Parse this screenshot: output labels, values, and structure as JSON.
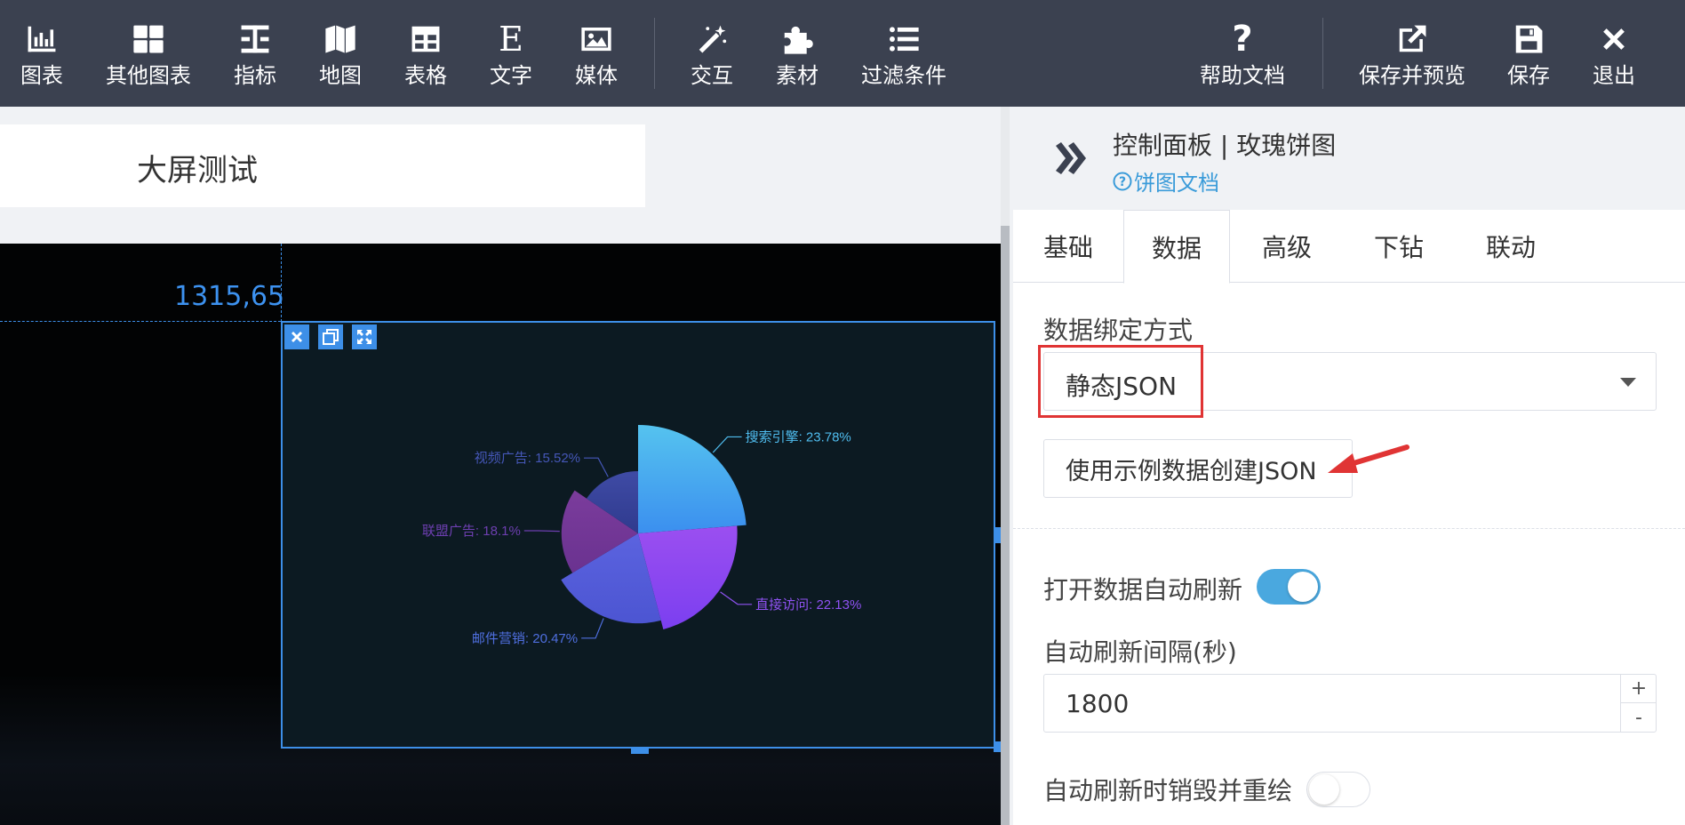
{
  "toolbar": {
    "left_items": [
      {
        "label": "图表",
        "icon": "bar-chart-icon"
      },
      {
        "label": "其他图表",
        "icon": "grid-icon"
      },
      {
        "label": "指标",
        "icon": "indicator-icon"
      },
      {
        "label": "地图",
        "icon": "map-icon"
      },
      {
        "label": "表格",
        "icon": "table-icon"
      },
      {
        "label": "文字",
        "icon": "text-icon"
      },
      {
        "label": "媒体",
        "icon": "image-icon"
      },
      {
        "label": "交互",
        "icon": "magic-wand-icon"
      },
      {
        "label": "素材",
        "icon": "puzzle-icon"
      },
      {
        "label": "过滤条件",
        "icon": "list-icon"
      }
    ],
    "right_items": [
      {
        "label": "帮助文档",
        "icon": "question-icon"
      },
      {
        "label": "保存并预览",
        "icon": "external-link-icon"
      },
      {
        "label": "保存",
        "icon": "floppy-icon"
      },
      {
        "label": "退出",
        "icon": "close-icon"
      }
    ]
  },
  "canvas": {
    "title": "大屏测试",
    "coordinate_readout": "1315,65"
  },
  "chart_data": {
    "type": "pie",
    "variant": "rose",
    "categories": [
      "搜索引擎",
      "直接访问",
      "邮件营销",
      "联盟广告",
      "视频广告"
    ],
    "labels": [
      "搜索引擎: 23.78%",
      "直接访问: 22.13%",
      "邮件营销: 20.47%",
      "联盟广告: 18.1%",
      "视频广告: 15.52%"
    ],
    "values": [
      23.78,
      22.13,
      20.47,
      18.1,
      15.52
    ],
    "colors": {
      "slice_top": [
        "#55c3ef",
        "#9b4ff0",
        "#5b63df",
        "#7b3c9c",
        "#3f4ba5"
      ],
      "slice_bottom": [
        "#3b8fef",
        "#7b3ff0",
        "#4c55d2",
        "#6a3290",
        "#2f3a8e"
      ],
      "label": [
        "#4fbcee",
        "#8f52f2",
        "#4f6fe0",
        "#6d3fb0",
        "#4557b8"
      ]
    }
  },
  "panel": {
    "title": "控制面板 | 玫瑰饼图",
    "doc_link": "饼图文档",
    "tabs": [
      "基础",
      "数据",
      "高级",
      "下钻",
      "联动"
    ],
    "active_tab": "数据",
    "binding_label": "数据绑定方式",
    "binding_value": "静态JSON",
    "sample_button": "使用示例数据创建JSON",
    "auto_refresh_label": "打开数据自动刷新",
    "auto_refresh_on": true,
    "interval_label": "自动刷新间隔(秒)",
    "interval_value": "1800",
    "destroy_label": "自动刷新时销毁并重绘",
    "destroy_on": false
  },
  "colors": {
    "toolbar_bg": "#3b4150",
    "accent": "#3d8fe8",
    "highlight_red": "#e03434",
    "switch_on": "#4aa8df"
  }
}
